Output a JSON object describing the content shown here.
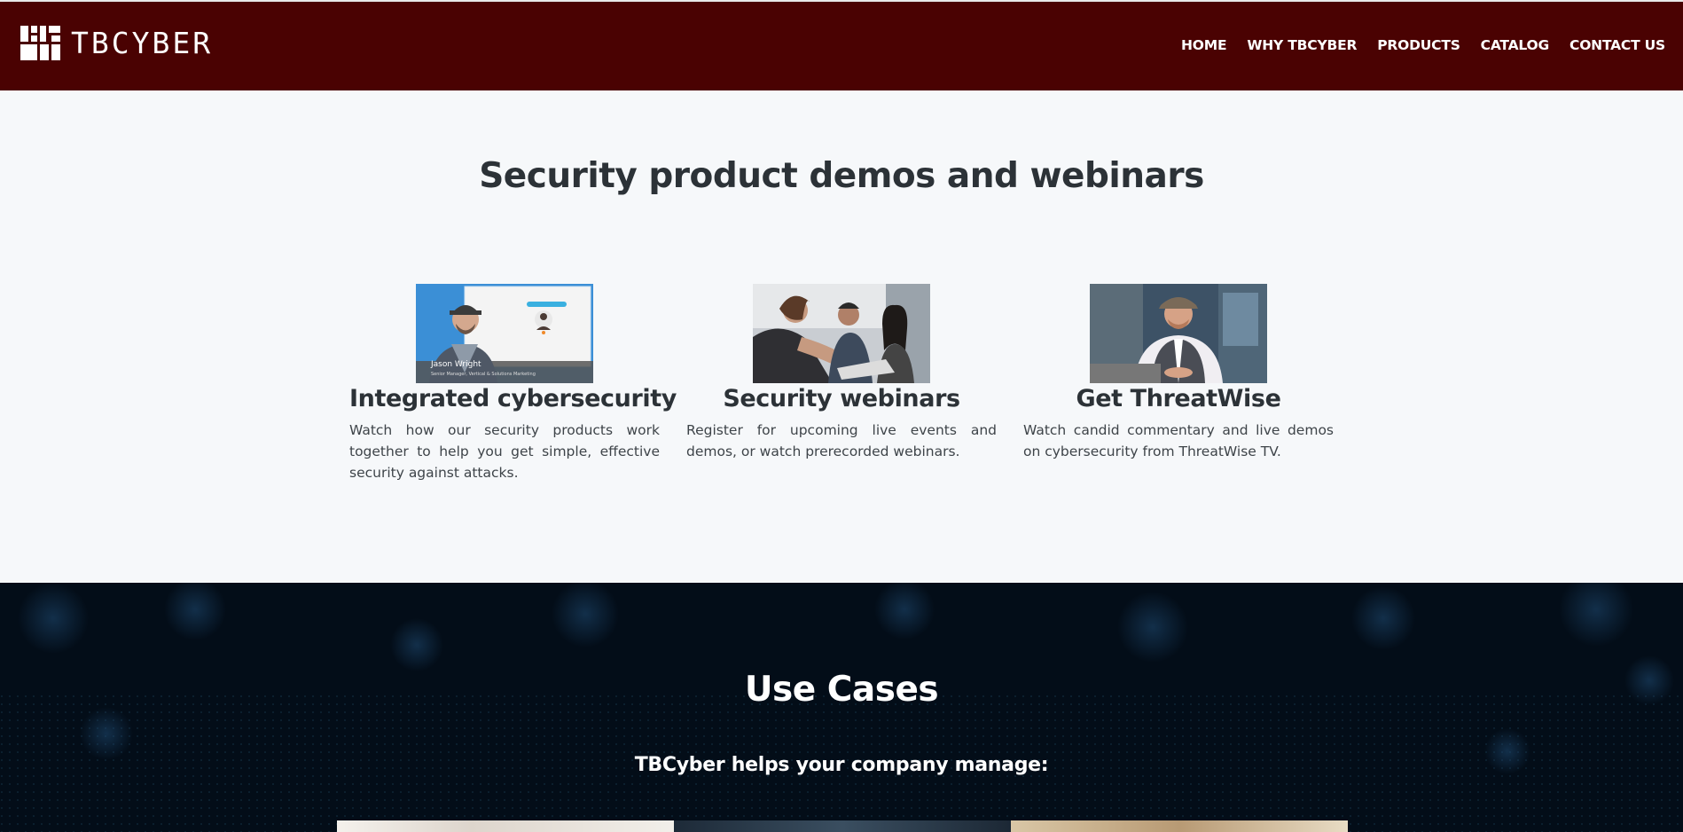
{
  "brand": {
    "name": "TBCYBER",
    "colors": {
      "navbar": "#4a0202",
      "heading": "#2c3237",
      "body_text": "#3e4449",
      "light_bg": "#f6f8fa",
      "dark_bg": "#030d18"
    }
  },
  "nav": {
    "items": [
      {
        "label": "HOME"
      },
      {
        "label": "WHY TBCYBER"
      },
      {
        "label": "PRODUCTS"
      },
      {
        "label": "CATALOG"
      },
      {
        "label": "CONTACT US"
      }
    ]
  },
  "demos": {
    "title": "Security product demos and webinars",
    "cards": [
      {
        "title": "Integrated cybersecurity",
        "description": "Watch how our security products work together to help you get simple, effective security against attacks.",
        "image": {
          "icon": "video-thumbnail-presenter",
          "presenter_name": "Jason Wright",
          "presenter_role": "Senior Manager, Vertical & Solutions Marketing"
        }
      },
      {
        "title": "Security webinars",
        "description": "Register for upcoming live events and demos, or watch prerecorded webinars.",
        "image": {
          "icon": "photo-people-at-laptop"
        }
      },
      {
        "title": "Get ThreatWise",
        "description": "Watch candid commentary and live demos on cybersecurity from ThreatWise TV.",
        "image": {
          "icon": "photo-host-at-desk"
        }
      }
    ]
  },
  "use_cases": {
    "title": "Use Cases",
    "subtitle": "TBCyber helps your company manage:"
  }
}
